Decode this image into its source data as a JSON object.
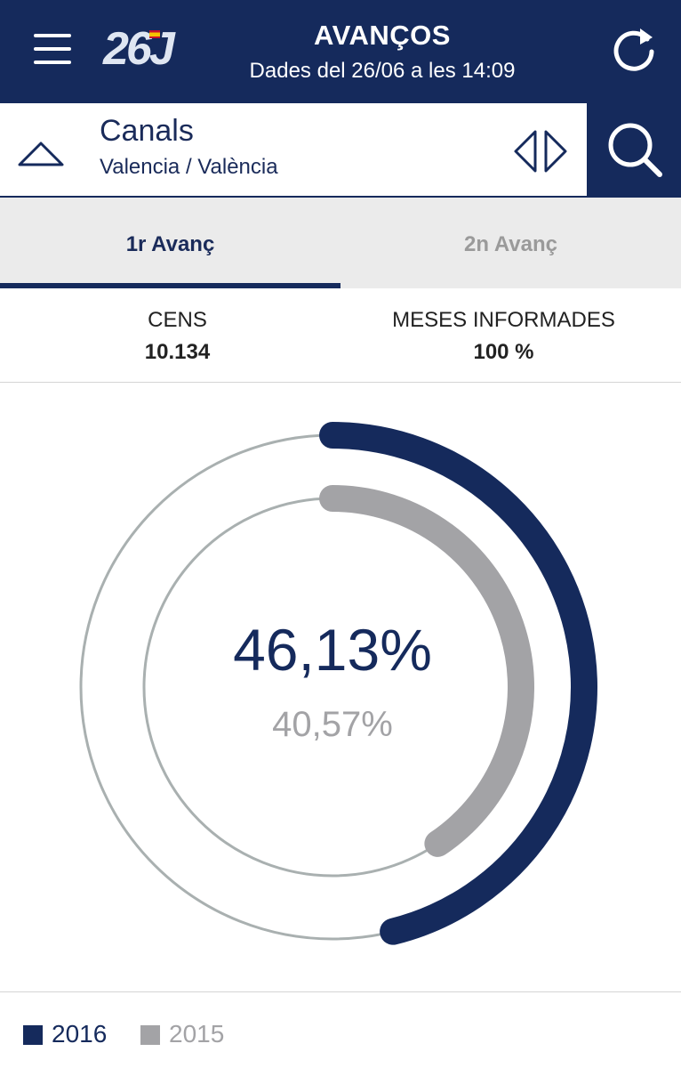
{
  "header": {
    "logo_text": "26J",
    "title": "AVANÇOS",
    "subtitle": "Dades del 26/06 a les 14:09",
    "menu_icon": "hamburger-icon",
    "refresh_icon": "refresh-icon"
  },
  "location": {
    "name": "Canals",
    "region": "Valencia / València",
    "collapse_icon": "triangle-up-icon",
    "nav_icon": "prev-next-arrows-icon",
    "search_icon": "search-icon"
  },
  "tabs": [
    {
      "label": "1r Avanç",
      "active": true
    },
    {
      "label": "2n Avanç",
      "active": false
    }
  ],
  "stats": {
    "census_label": "CENS",
    "census_value": "10.134",
    "tables_label": "MESES INFORMADES",
    "tables_value": "100 %"
  },
  "participation": {
    "current_text": "46,13%",
    "previous_text": "40,57%",
    "current_value": 46.13,
    "previous_value": 40.57
  },
  "legend": [
    {
      "label": "2016",
      "color": "#152a5c"
    },
    {
      "label": "2015",
      "color": "#a3a3a6"
    }
  ],
  "colors": {
    "primary": "#152a5c",
    "secondary": "#a3a3a6",
    "track": "#a9b0b0"
  }
}
